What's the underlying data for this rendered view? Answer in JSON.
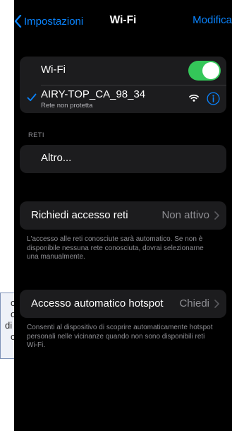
{
  "background_window": {
    "lines": [
      "c",
      "o",
      "di",
      "co"
    ]
  },
  "navbar": {
    "back_label": "Impostazioni",
    "title": "Wi-Fi",
    "edit_label": "Modifica"
  },
  "wifi": {
    "label": "Wi-Fi",
    "enabled": true,
    "connected_network": {
      "name": "AIRY-TOP_CA_98_34",
      "subtitle": "Rete non protetta"
    }
  },
  "networks": {
    "header": "RETI",
    "other_label": "Altro..."
  },
  "ask_to_join": {
    "label": "Richiedi accesso reti",
    "value": "Non attivo",
    "footnote": "L'accesso alle reti conosciute sarà automatico. Se non è disponibile nessuna rete conosciuta, dovrai selezionarne una manualmente."
  },
  "auto_hotspot": {
    "label": "Accesso automatico hotspot",
    "value": "Chiedi",
    "footnote": "Consenti al dispositivo di scoprire automaticamente hotspot personali nelle vicinanze quando non sono disponibili reti Wi-Fi."
  },
  "colors": {
    "accent": "#0a84ff",
    "toggle_on": "#34c759",
    "cell": "#1c1c1e",
    "secondary_text": "#8e8e93"
  },
  "icons": [
    "chevron-left-icon",
    "checkmark-icon",
    "wifi-signal-icon",
    "info-icon",
    "chevron-right-icon"
  ]
}
